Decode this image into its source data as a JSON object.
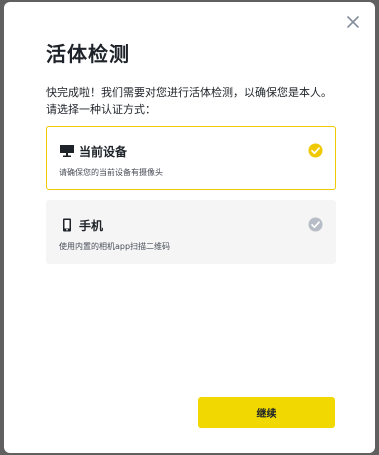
{
  "dialog": {
    "title": "活体检测",
    "description": "快完成啦！我们需要对您进行活体检测，以确保您是本人。请选择一种认证方式：",
    "close_icon": "close-icon"
  },
  "options": [
    {
      "icon": "monitor-icon",
      "label": "当前设备",
      "sublabel": "请确保您的当前设备有摄像头",
      "selected": true,
      "check_color": "#f0c900"
    },
    {
      "icon": "phone-icon",
      "label": "手机",
      "sublabel": "使用内置的相机app扫描二维码",
      "selected": false,
      "check_color": "#b7bdc6"
    }
  ],
  "footer": {
    "continue_label": "继续"
  },
  "colors": {
    "accent": "#f0d800",
    "selected_border": "#f0c900",
    "text_primary": "#1e2329",
    "text_secondary": "#474d57",
    "option_bg": "#f5f5f5",
    "backdrop": "#606060"
  }
}
